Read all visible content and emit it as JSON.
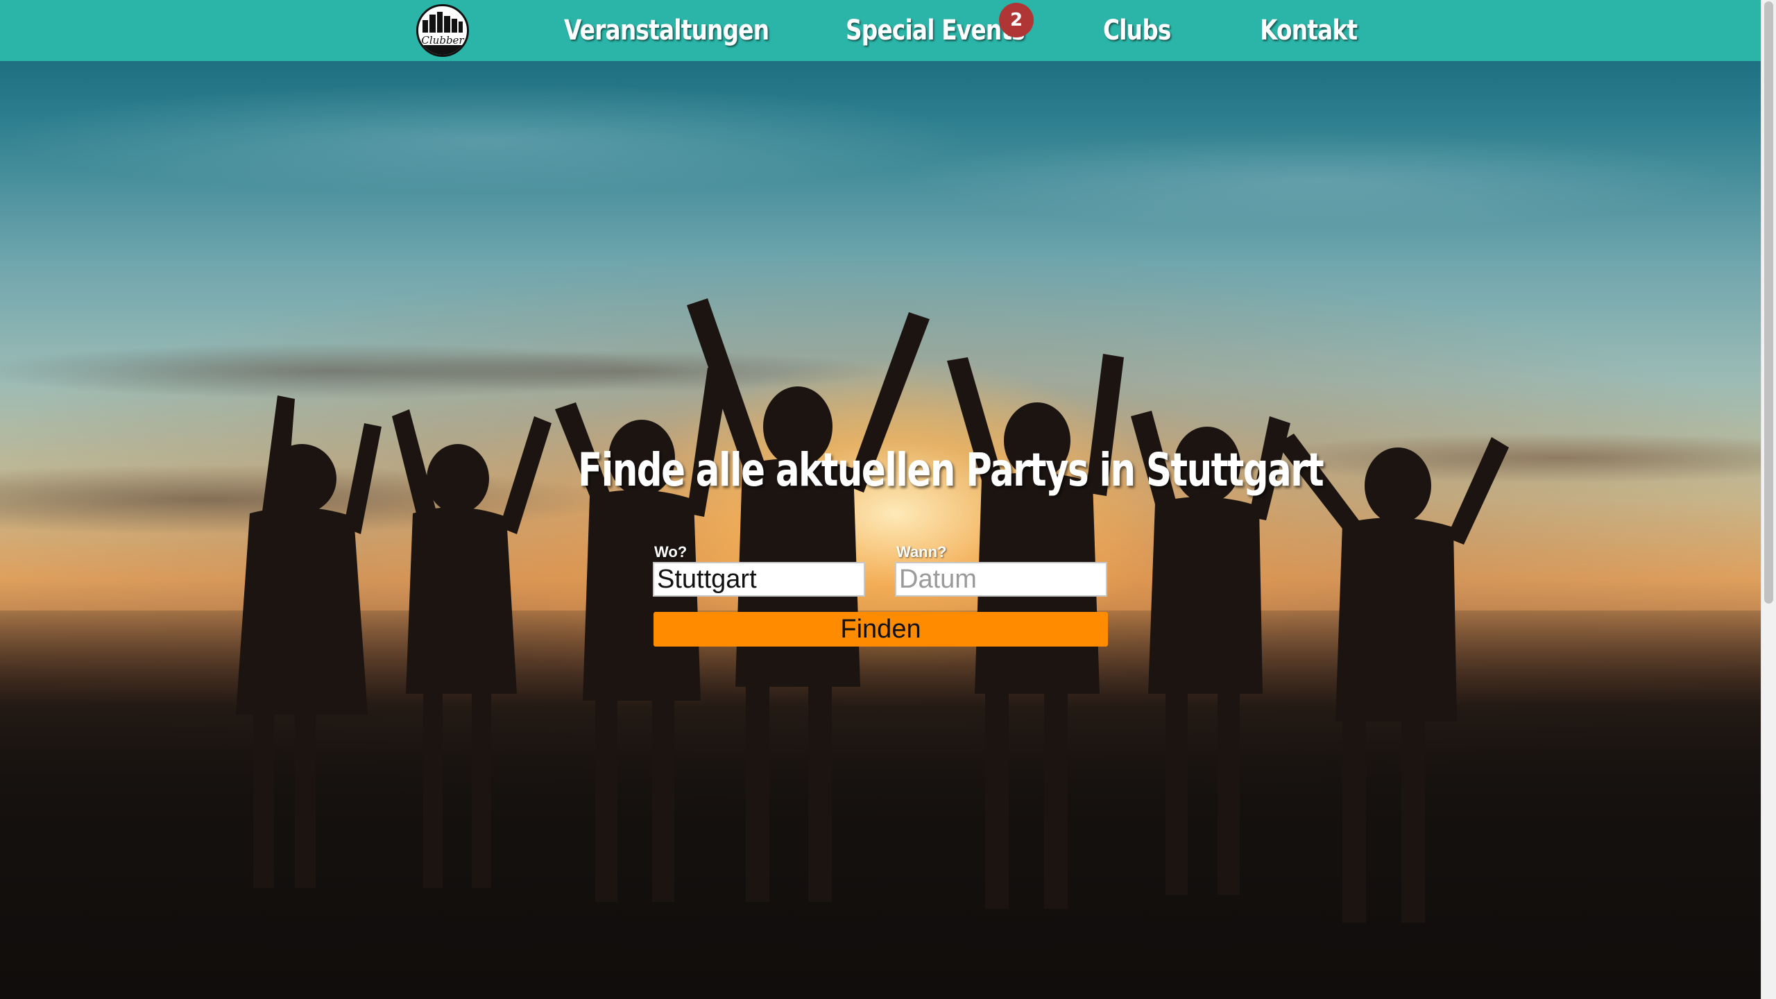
{
  "navbar": {
    "logo_text": "Clubber",
    "items": [
      {
        "label": "Veranstaltungen"
      },
      {
        "label": "Special Events",
        "badge": "2"
      },
      {
        "label": "Clubs"
      },
      {
        "label": "Kontakt"
      }
    ],
    "background": "#2bb5a8",
    "badge_color": "#b03535"
  },
  "hero": {
    "headline": "Finde alle aktuellen Partys in Stuttgart"
  },
  "search": {
    "where_label": "Wo?",
    "where_value": "Stuttgart",
    "when_label": "Wann?",
    "when_placeholder": "Datum",
    "submit_label": "Finden",
    "button_color": "#ff8c00"
  }
}
